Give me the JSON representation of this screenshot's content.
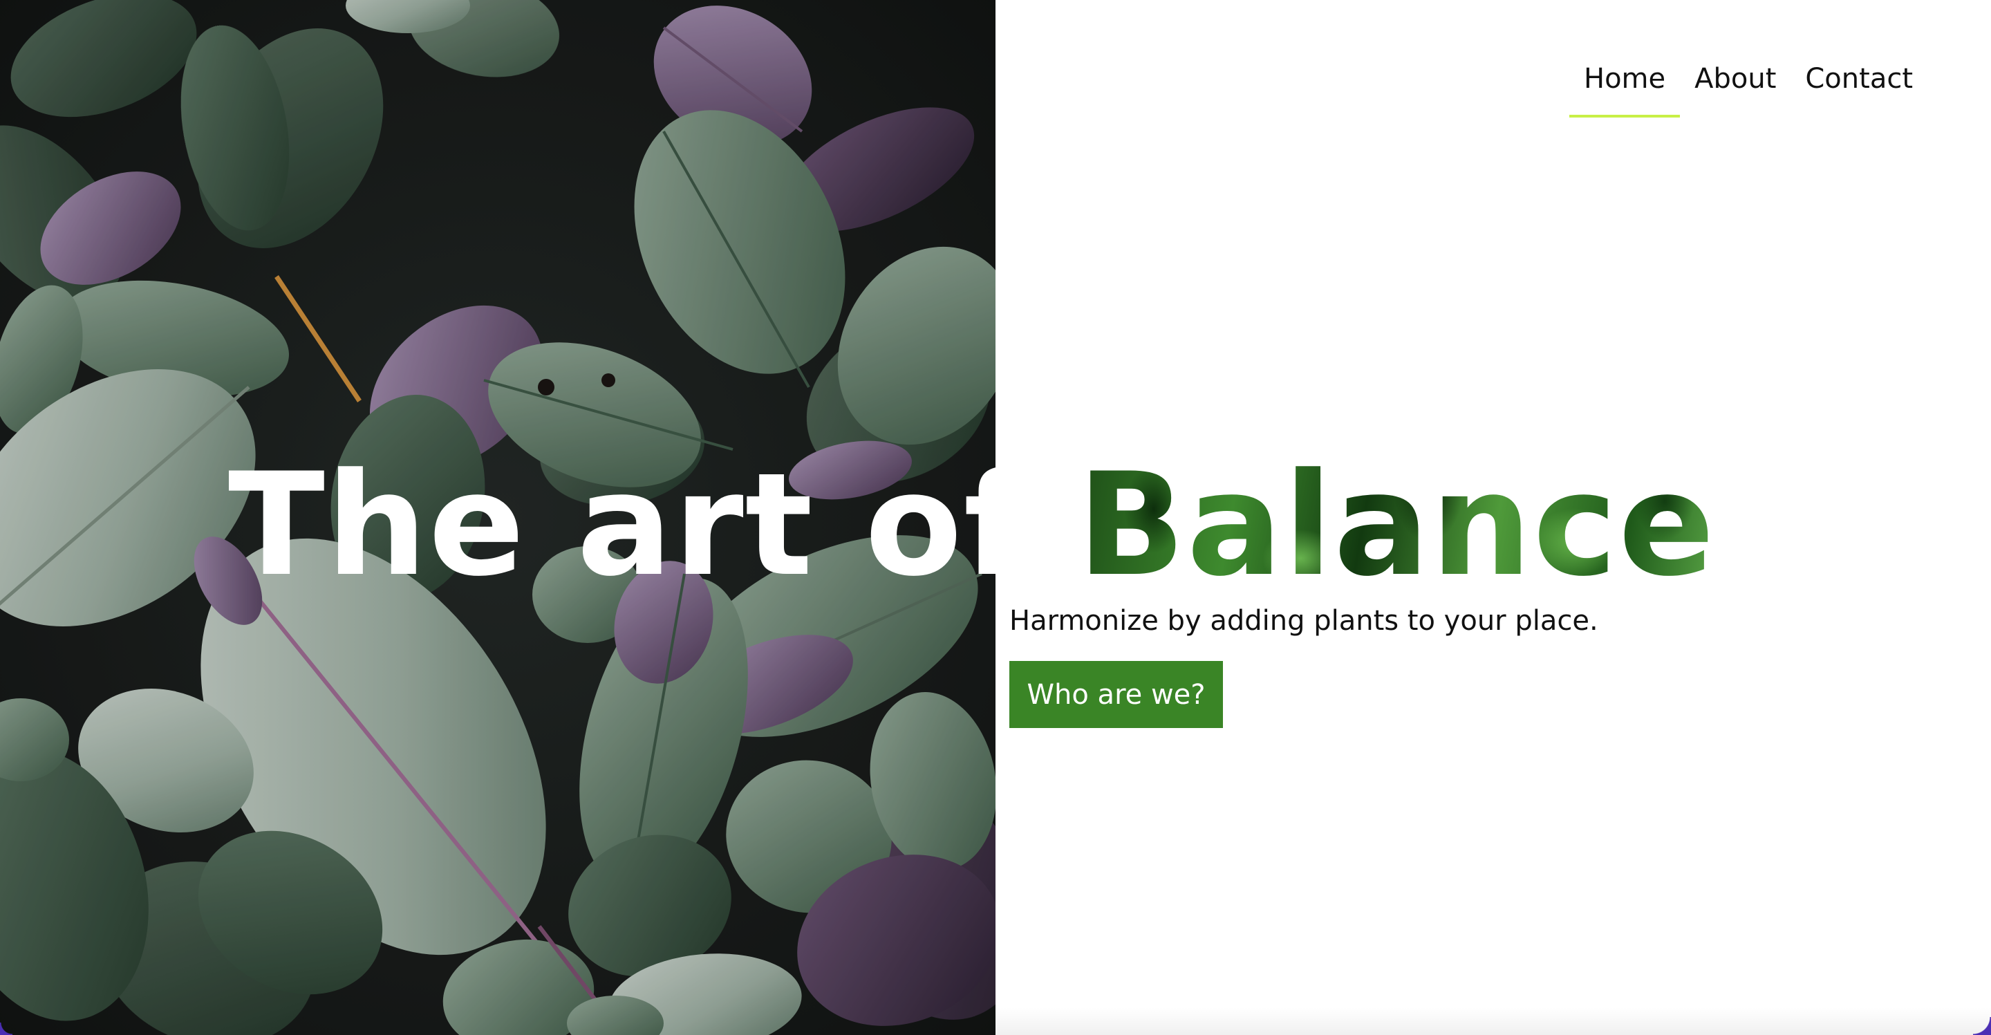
{
  "nav": {
    "items": [
      {
        "label": "Home",
        "active": true
      },
      {
        "label": "About",
        "active": false
      },
      {
        "label": "Contact",
        "active": false
      }
    ],
    "active_underline_color": "#c8f046"
  },
  "hero": {
    "title_part_1": "The art of ",
    "title_part_2": "Balance",
    "subtitle": "Harmonize by adding plants to your place.",
    "cta_label": "Who are we?",
    "cta_color": "#3a8526"
  },
  "photo": {
    "subject": "leaves-photo"
  }
}
